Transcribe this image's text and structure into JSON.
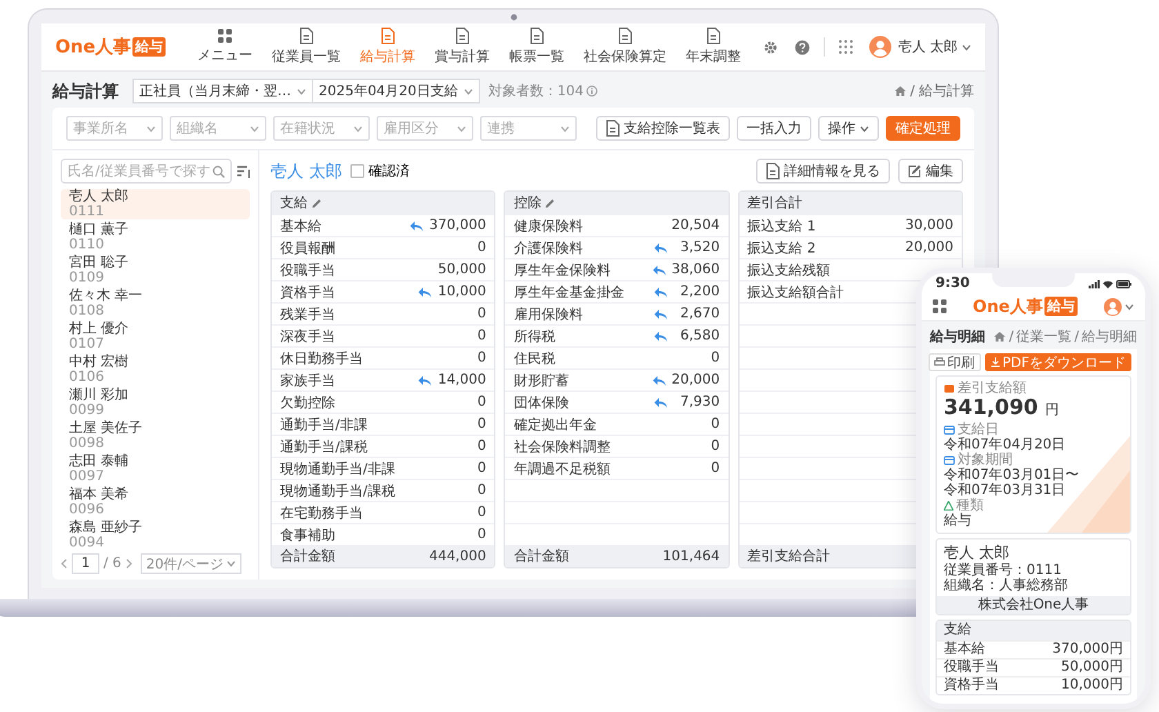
{
  "nav": {
    "logo": "One人事",
    "logo_badge": "給与",
    "user": "壱人 太郎",
    "items": [
      {
        "label": "メニュー",
        "kind": "menu",
        "selected": false
      },
      {
        "label": "従業員一覧",
        "kind": "page",
        "selected": false
      },
      {
        "label": "給与計算",
        "kind": "page",
        "selected": true
      },
      {
        "label": "賞与計算",
        "kind": "page",
        "selected": false
      },
      {
        "label": "帳票一覧",
        "kind": "page",
        "selected": false
      },
      {
        "label": "社会保険算定",
        "kind": "page",
        "selected": false
      },
      {
        "label": "年末調整",
        "kind": "page",
        "selected": false
      }
    ]
  },
  "page": {
    "title": "給与計算",
    "group_select": "正社員（当月末締・翌…",
    "date_select": "2025年04月20日支給",
    "count": "対象者数：104",
    "breadcrumb_separator": "/",
    "breadcrumb": [
      "給与計算"
    ]
  },
  "filters": [
    {
      "placeholder": "事業所名"
    },
    {
      "placeholder": "組織名"
    },
    {
      "placeholder": "在籍状況"
    },
    {
      "placeholder": "雇用区分"
    },
    {
      "placeholder": "連携"
    }
  ],
  "actions": [
    {
      "label": "支給控除一覧表",
      "kind": "report"
    },
    {
      "label": "一括入力",
      "kind": "plain"
    },
    {
      "label": "操作",
      "kind": "menu"
    },
    {
      "label": "確定処理",
      "kind": "primary"
    }
  ],
  "employee_list": {
    "search_placeholder": "氏名/従業員番号で探す",
    "page": "1",
    "pages": "/ 6",
    "page_size": "20件/ページ",
    "employees": [
      {
        "name": "壱人 太郎",
        "number": "0111",
        "selected": true
      },
      {
        "name": "樋口 薫子",
        "number": "0110",
        "selected": false
      },
      {
        "name": "宮田 聡子",
        "number": "0109",
        "selected": false
      },
      {
        "name": "佐々木 幸一",
        "number": "0108",
        "selected": false
      },
      {
        "name": "村上 優介",
        "number": "0107",
        "selected": false
      },
      {
        "name": "中村 宏樹",
        "number": "0106",
        "selected": false
      },
      {
        "name": "瀬川 彩加",
        "number": "0099",
        "selected": false
      },
      {
        "name": "土屋 美佐子",
        "number": "0098",
        "selected": false
      },
      {
        "name": "志田 泰輔",
        "number": "0097",
        "selected": false
      },
      {
        "name": "福本 美希",
        "number": "0096",
        "selected": false
      },
      {
        "name": "森島 亜紗子",
        "number": "0094",
        "selected": false
      }
    ]
  },
  "detail": {
    "name": "壱人 太郎",
    "confirmed": {
      "label": "確認済",
      "checked": false
    },
    "buttons": [
      {
        "label": "詳細情報を見る",
        "kind": "view"
      },
      {
        "label": "編集",
        "kind": "edit"
      }
    ],
    "tables": [
      {
        "title": "支給",
        "editable": true,
        "total_label": "合計金額",
        "total_value": "444,000",
        "rows": [
          {
            "label": "基本給",
            "value": "370,000",
            "edited": true
          },
          {
            "label": "役員報酬",
            "value": "0",
            "edited": false
          },
          {
            "label": "役職手当",
            "value": "50,000",
            "edited": false
          },
          {
            "label": "資格手当",
            "value": "10,000",
            "edited": true
          },
          {
            "label": "残業手当",
            "value": "0",
            "edited": false
          },
          {
            "label": "深夜手当",
            "value": "0",
            "edited": false
          },
          {
            "label": "休日勤務手当",
            "value": "0",
            "edited": false
          },
          {
            "label": "家族手当",
            "value": "14,000",
            "edited": true
          },
          {
            "label": "欠勤控除",
            "value": "0",
            "edited": false
          },
          {
            "label": "通勤手当/非課",
            "value": "0",
            "edited": false
          },
          {
            "label": "通勤手当/課税",
            "value": "0",
            "edited": false
          },
          {
            "label": "現物通勤手当/非課",
            "value": "0",
            "edited": false
          },
          {
            "label": "現物通勤手当/課税",
            "value": "0",
            "edited": false
          },
          {
            "label": "在宅勤務手当",
            "value": "0",
            "edited": false
          },
          {
            "label": "食事補助",
            "value": "0",
            "edited": false
          }
        ]
      },
      {
        "title": "控除",
        "editable": true,
        "total_label": "合計金額",
        "total_value": "101,464",
        "rows": [
          {
            "label": "健康保険料",
            "value": "20,504",
            "edited": false
          },
          {
            "label": "介護保険料",
            "value": "3,520",
            "edited": true
          },
          {
            "label": "厚生年金保険料",
            "value": "38,060",
            "edited": true
          },
          {
            "label": "厚生年金基金掛金",
            "value": "2,200",
            "edited": true
          },
          {
            "label": "雇用保険料",
            "value": "2,670",
            "edited": true
          },
          {
            "label": "所得税",
            "value": "6,580",
            "edited": true
          },
          {
            "label": "住民税",
            "value": "0",
            "edited": false
          },
          {
            "label": "財形貯蓄",
            "value": "20,000",
            "edited": true
          },
          {
            "label": "団体保険",
            "value": "7,930",
            "edited": true
          },
          {
            "label": "確定拠出年金",
            "value": "0",
            "edited": false
          },
          {
            "label": "社会保険料調整",
            "value": "0",
            "edited": false
          },
          {
            "label": "年調過不足税額",
            "value": "0",
            "edited": false
          }
        ]
      },
      {
        "title": "差引合計",
        "editable": false,
        "total_label": "差引支給合計",
        "rows": [
          {
            "label": "振込支給 1",
            "value": "30,000",
            "edited": false
          },
          {
            "label": "振込支給 2",
            "value": "20,000",
            "edited": false
          },
          {
            "label": "振込支給残額",
            "edited": false
          },
          {
            "label": "振込支給額合計",
            "edited": false
          }
        ]
      }
    ]
  },
  "phone": {
    "time": "9:30",
    "logo": "One人事",
    "logo_badge": "給与",
    "title": "給与明細",
    "breadcrumb_separator": "/",
    "breadcrumb": [
      "従業一覧",
      "給与明細"
    ],
    "buttons": [
      {
        "label": "印刷",
        "kind": "print"
      },
      {
        "label": "PDFをダウンロード",
        "kind": "download"
      }
    ],
    "net_label": "差引支給額",
    "net_amount": "341,090",
    "net_unit": "円",
    "fields": [
      {
        "label": "支給日",
        "kind": "date",
        "lines": [
          "令和07年04月20日"
        ]
      },
      {
        "label": "対象期間",
        "kind": "date",
        "lines": [
          "令和07年03月01日〜",
          "令和07年03月31日"
        ]
      },
      {
        "label": "種類",
        "kind": "type",
        "lines": [
          "給与"
        ]
      }
    ],
    "employee": {
      "name": "壱人 太郎",
      "details": [
        "従業員番号：0111",
        "組織名：人事総務部"
      ],
      "company": "株式会社One人事"
    },
    "section": {
      "title": "支給",
      "rows": [
        {
          "label": "基本給",
          "value": "370,000円"
        },
        {
          "label": "役職手当",
          "value": "50,000円"
        },
        {
          "label": "資格手当",
          "value": "10,000円"
        }
      ]
    }
  }
}
